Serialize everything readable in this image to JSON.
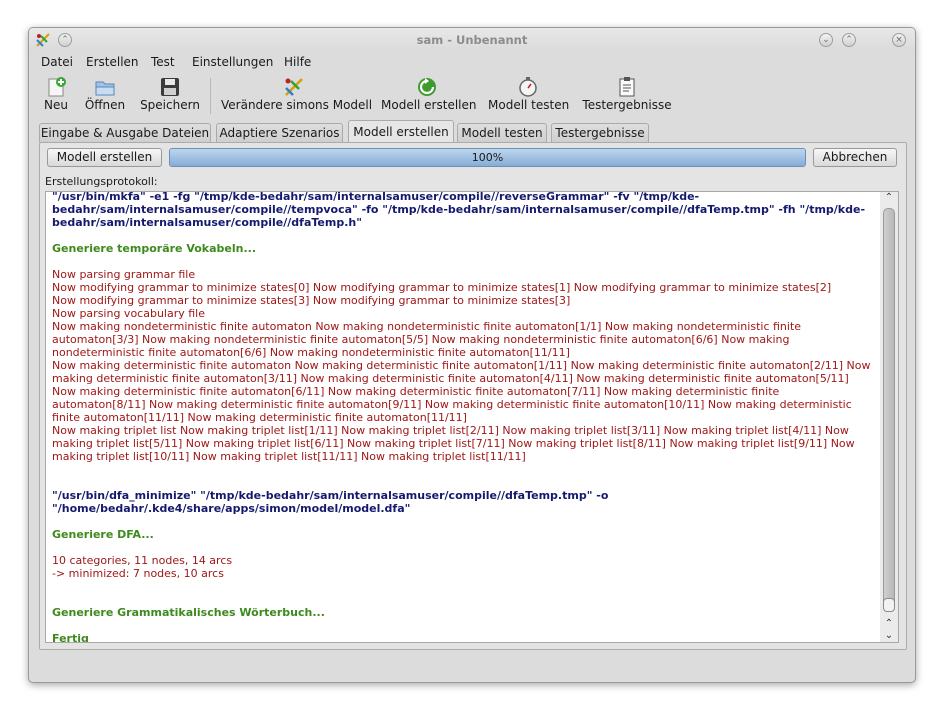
{
  "window": {
    "title": "sam - Unbenannt",
    "btn_shade": "⌃",
    "btn_minimize": "⌄",
    "btn_maximize": "⌃",
    "btn_close": "×"
  },
  "menu": [
    {
      "label": "Datei"
    },
    {
      "label": "Erstellen"
    },
    {
      "label": "Test"
    },
    {
      "label": "Einstellungen"
    },
    {
      "label": "Hilfe"
    }
  ],
  "toolbar": {
    "new": "Neu",
    "open": "Öffnen",
    "save": "Speichern",
    "change_model": "Verändere simons Modell",
    "build_model": "Modell erstellen",
    "test_model": "Modell testen",
    "test_results": "Testergebnisse"
  },
  "tabs": [
    {
      "label": "Eingabe & Ausgabe Dateien"
    },
    {
      "label": "Adaptiere Szenarios"
    },
    {
      "label": "Modell erstellen",
      "active": true
    },
    {
      "label": "Modell testen"
    },
    {
      "label": "Testergebnisse"
    }
  ],
  "panel": {
    "build_button": "Modell erstellen",
    "progress_value": 100,
    "progress_text": "100%",
    "cancel_button": "Abbrechen",
    "log_label": "Erstellungsprotokoll:"
  },
  "log": [
    {
      "type": "cmd",
      "text": "\"/usr/bin/mkfa\" -e1 -fg \"/tmp/kde-bedahr/sam/internalsamuser/compile//reverseGrammar\" -fv \"/tmp/kde-bedahr/sam/internalsamuser/compile//tempvoca\" -fo \"/tmp/kde-bedahr/sam/internalsamuser/compile//dfaTemp.tmp\" -fh \"/tmp/kde-bedahr/sam/internalsamuser/compile//dfaTemp.h\""
    },
    {
      "type": "head",
      "text": "Generiere temporäre Vokabeln..."
    },
    {
      "type": "out",
      "text": "Now parsing grammar file"
    },
    {
      "type": "out",
      "text": "Now modifying grammar to minimize states[0] Now modifying grammar to minimize states[1] Now modifying grammar to minimize states[2]"
    },
    {
      "type": "out",
      "text": "Now modifying grammar to minimize states[3] Now modifying grammar to minimize states[3]"
    },
    {
      "type": "out",
      "text": "Now parsing vocabulary file"
    },
    {
      "type": "out",
      "text": "Now making nondeterministic finite automaton Now making nondeterministic finite automaton[1/1] Now making nondeterministic finite automaton[3/3] Now making nondeterministic finite automaton[5/5] Now making nondeterministic finite automaton[6/6] Now making nondeterministic finite automaton[6/6] Now making nondeterministic finite automaton[11/11]"
    },
    {
      "type": "out",
      "text": "Now making deterministic finite automaton Now making deterministic finite automaton[1/11] Now making deterministic finite automaton[2/11] Now making deterministic finite automaton[3/11] Now making deterministic finite automaton[4/11] Now making deterministic finite automaton[5/11] Now making deterministic finite automaton[6/11] Now making deterministic finite automaton[7/11] Now making deterministic finite automaton[8/11] Now making deterministic finite automaton[9/11] Now making deterministic finite automaton[10/11] Now making deterministic finite automaton[11/11] Now making deterministic finite automaton[11/11]"
    },
    {
      "type": "out",
      "text": "Now making triplet list Now making triplet list[1/11] Now making triplet list[2/11] Now making triplet list[3/11] Now making triplet list[4/11] Now making triplet list[5/11] Now making triplet list[6/11] Now making triplet list[7/11] Now making triplet list[8/11] Now making triplet list[9/11] Now making triplet list[10/11] Now making triplet list[11/11] Now making triplet list[11/11]"
    },
    {
      "type": "cmd",
      "text": "\"/usr/bin/dfa_minimize\" \"/tmp/kde-bedahr/sam/internalsamuser/compile//dfaTemp.tmp\" -o \"/home/bedahr/.kde4/share/apps/simon/model/model.dfa\""
    },
    {
      "type": "head",
      "text": "Generiere DFA..."
    },
    {
      "type": "out",
      "text": "10 categories, 11 nodes, 14 arcs"
    },
    {
      "type": "out",
      "text": "-> minimized: 7 nodes, 10 arcs"
    },
    {
      "type": "head",
      "text": "Generiere Grammatikalisches Wörterbuch..."
    },
    {
      "type": "head",
      "text": "Fertig"
    }
  ],
  "colors": {
    "cmd": "#14196e",
    "heading": "#3d8a1d",
    "output": "#a01818",
    "progress": "#86acd6"
  }
}
